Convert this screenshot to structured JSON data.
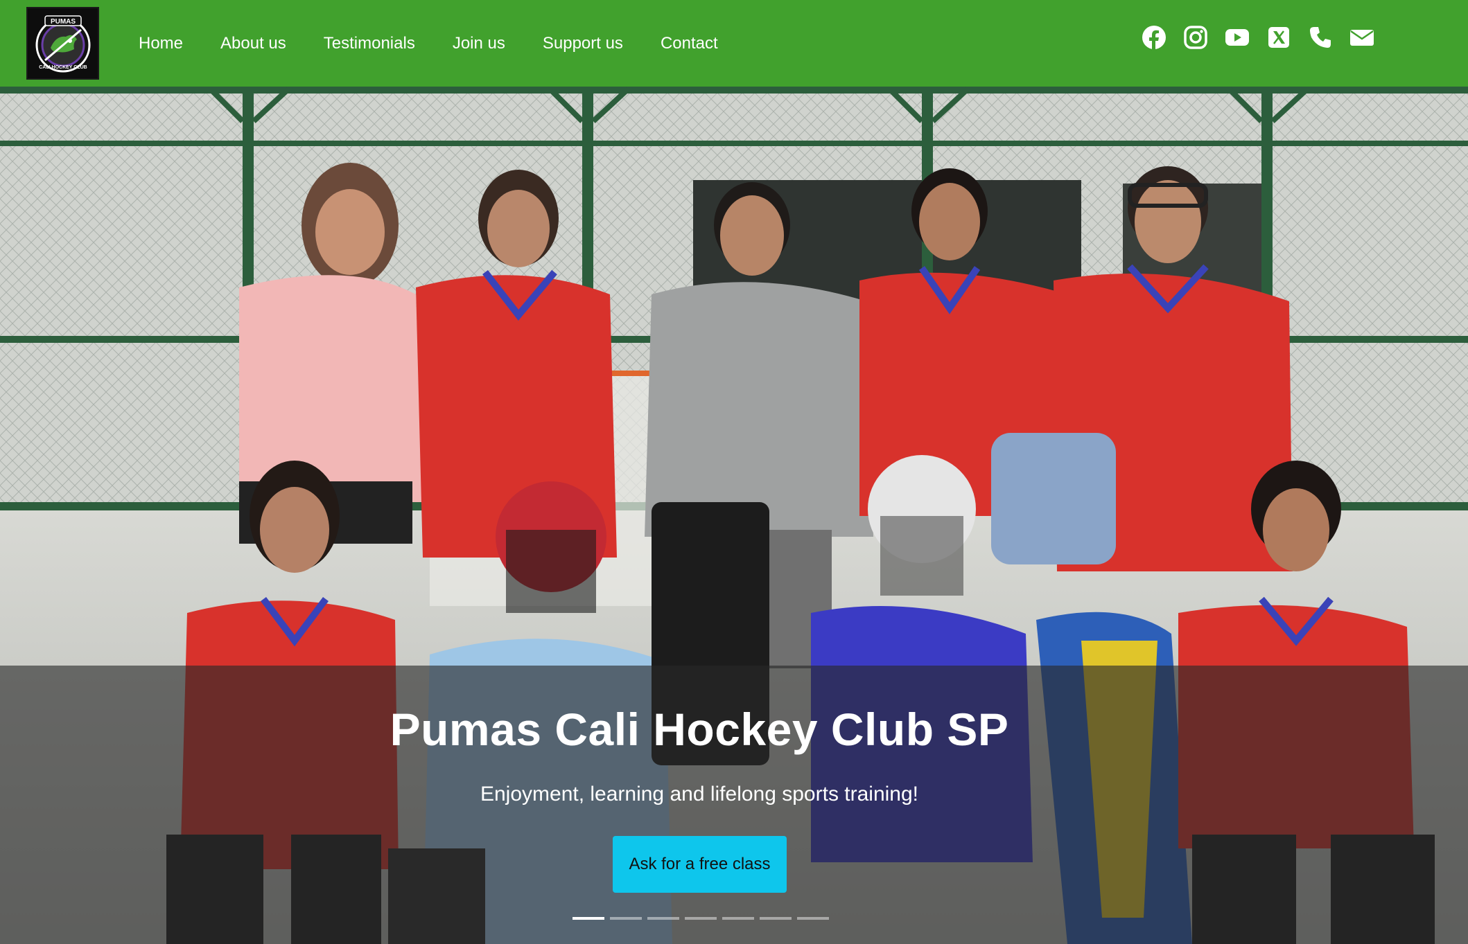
{
  "brand": {
    "logo_text_top": "PUMAS",
    "logo_text_bottom": "CALI HOCKEY CLUB"
  },
  "nav": {
    "items": [
      {
        "label": "Home"
      },
      {
        "label": "About us"
      },
      {
        "label": "Testimonials"
      },
      {
        "label": "Join us"
      },
      {
        "label": "Support us"
      },
      {
        "label": "Contact"
      }
    ]
  },
  "social": [
    {
      "icon": "facebook-icon"
    },
    {
      "icon": "instagram-icon"
    },
    {
      "icon": "youtube-icon"
    },
    {
      "icon": "x-twitter-icon"
    },
    {
      "icon": "phone-icon"
    },
    {
      "icon": "email-icon"
    }
  ],
  "hero": {
    "title": "Pumas Cali Hockey Club SP",
    "subtitle": "Enjoyment, learning and lifelong sports training!",
    "cta_label": "Ask for a free class",
    "slide_count": 7,
    "active_slide": 1
  },
  "colors": {
    "nav_bg": "#41a12d",
    "cta_bg": "#0ec6ec",
    "jersey_red": "#d8322c",
    "jersey_blue": "#3a43b8"
  }
}
